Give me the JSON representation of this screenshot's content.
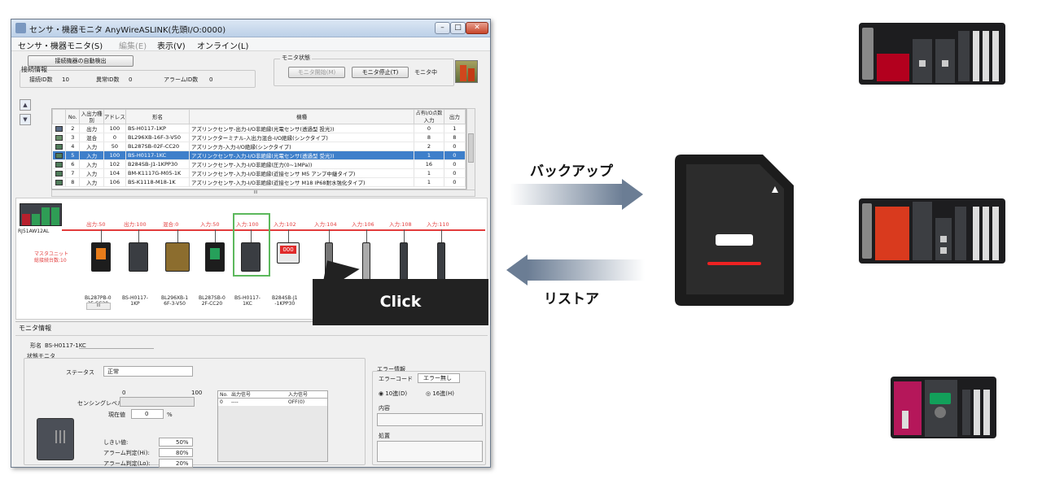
{
  "window": {
    "title": "センサ・機器モニタ AnyWireASLINK(先頭I/O:0000)",
    "btn_min": "–",
    "btn_max": "□",
    "btn_close": "✕"
  },
  "menu": {
    "items": [
      "センサ・機器モニタ(S)",
      "編集(E)",
      "表示(V)",
      "オンライン(L)"
    ]
  },
  "toolbar": {
    "autodetect_label": "接続機器の自動検出"
  },
  "connection": {
    "title": "接続情報",
    "connected_label": "接続ID数",
    "connected_value": "10",
    "error_label": "異常ID数",
    "error_value": "0",
    "alarm_label": "アラームID数",
    "alarm_value": "0"
  },
  "monitor_state": {
    "title": "モニタ状態",
    "start_label": "モニタ開始(M)",
    "stop_label": "モニタ停止(T)",
    "status": "モニタ中"
  },
  "table": {
    "headers": {
      "no": "No.",
      "io_type": "入出力種別",
      "address": "アドレス",
      "model": "形名",
      "device_type": "機種",
      "io_points": "占有I/O点数",
      "input": "入力",
      "output": "出力"
    },
    "rows": [
      {
        "no": "2",
        "io": "出力",
        "addr": "100",
        "model": "BS-H0117-1KP",
        "type": "アズリンクセンサ-出力-I/O非絶縁(光電センサ(透過型 投光))",
        "in": "0",
        "out": "1"
      },
      {
        "no": "3",
        "io": "混合",
        "addr": "0",
        "model": "BL296XB-16F-3-V50",
        "type": "アズリンクターミナル-入出力混合-I/O絶縁(シンクタイプ)",
        "in": "8",
        "out": "8"
      },
      {
        "no": "4",
        "io": "入力",
        "addr": "50",
        "model": "BL287SB-02F-CC20",
        "type": "アズリンクカ-入力-I/O絶縁(シンクタイプ)",
        "in": "2",
        "out": "0"
      },
      {
        "no": "5",
        "io": "入力",
        "addr": "100",
        "model": "BS-H0117-1KC",
        "type": "アズリンクセンサ-入力-I/O非絶縁(光電センサ(透過型 受光))",
        "in": "1",
        "out": "0"
      },
      {
        "no": "6",
        "io": "入力",
        "addr": "102",
        "model": "B284SB-J1-1KPP30",
        "type": "アズリンクセンサ-入力-I/O非絶縁(圧力(0~1MPa))",
        "in": "16",
        "out": "0"
      },
      {
        "no": "7",
        "io": "入力",
        "addr": "104",
        "model": "BM-K1117G-M05-1K",
        "type": "アズリンクセンサ-入力-I/O非絶縁(近接センサ M5 アンプ中継タイプ)",
        "in": "1",
        "out": "0"
      },
      {
        "no": "8",
        "io": "入力",
        "addr": "106",
        "model": "BS-K1118-M18-1K",
        "type": "アズリンクセンサ-入力-I/O非絶縁(近接センサ M18 IP68耐水強化タイプ)",
        "in": "1",
        "out": "0"
      }
    ],
    "selected_row": "5",
    "scroll_mark": "III"
  },
  "network": {
    "master_name": "RJ51AW12AL",
    "master_note_1": "マスタユニット",
    "master_note_2": "総接続台数:10",
    "device_labels": [
      "出力:50",
      "出力:100",
      "混合:0",
      "入力:50",
      "入力:100",
      "入力:102",
      "入力:104",
      "入力:106",
      "入力:108",
      "入力:110"
    ],
    "device_names": [
      "BL287PB-0\n2F-CC20",
      "BS-H0117-\n1KP",
      "BL296XB-1\n6F-3-V50",
      "BL287SB-0\n2F-CC20",
      "BS-H0117-\n1KC",
      "B284SB-J1\n-1KPP30",
      "BM",
      "",
      "",
      ""
    ],
    "gauge_text": "000",
    "scroll_mark": "III"
  },
  "callout": {
    "text": "Click"
  },
  "monitor_info": {
    "title": "モニタ情報",
    "model_label": "形名",
    "model_value": "BS-H0117-1KC",
    "status_monitor": "状態モニタ",
    "status_label": "ステータス",
    "status_value": "正常",
    "range_min": "0",
    "range_max": "100",
    "sensing_label": "センシングレベル",
    "current_label": "現在値",
    "current_value": "0",
    "unit": "%",
    "threshold_label": "しきい値:",
    "threshold_value": "50%",
    "alarm_hi_label": "アラーム判定(Hi):",
    "alarm_hi_value": "80%",
    "alarm_lo_label": "アラーム判定(Lo):",
    "alarm_lo_value": "20%",
    "io_table": {
      "h_no": "No.",
      "h_out": "出力信号",
      "h_in": "入力信号",
      "r_no": "0",
      "r_out": "----",
      "r_in": "OFF(0)"
    },
    "error_title": "エラー情報",
    "error_code_label": "エラーコード",
    "error_code_value": "エラー無し",
    "radix_dec": "10進(D)",
    "radix_hex": "16進(H)",
    "content_label": "内容",
    "action_label": "処置"
  },
  "diagram": {
    "backup_label": "バックアップ",
    "restore_label": "リストア"
  }
}
